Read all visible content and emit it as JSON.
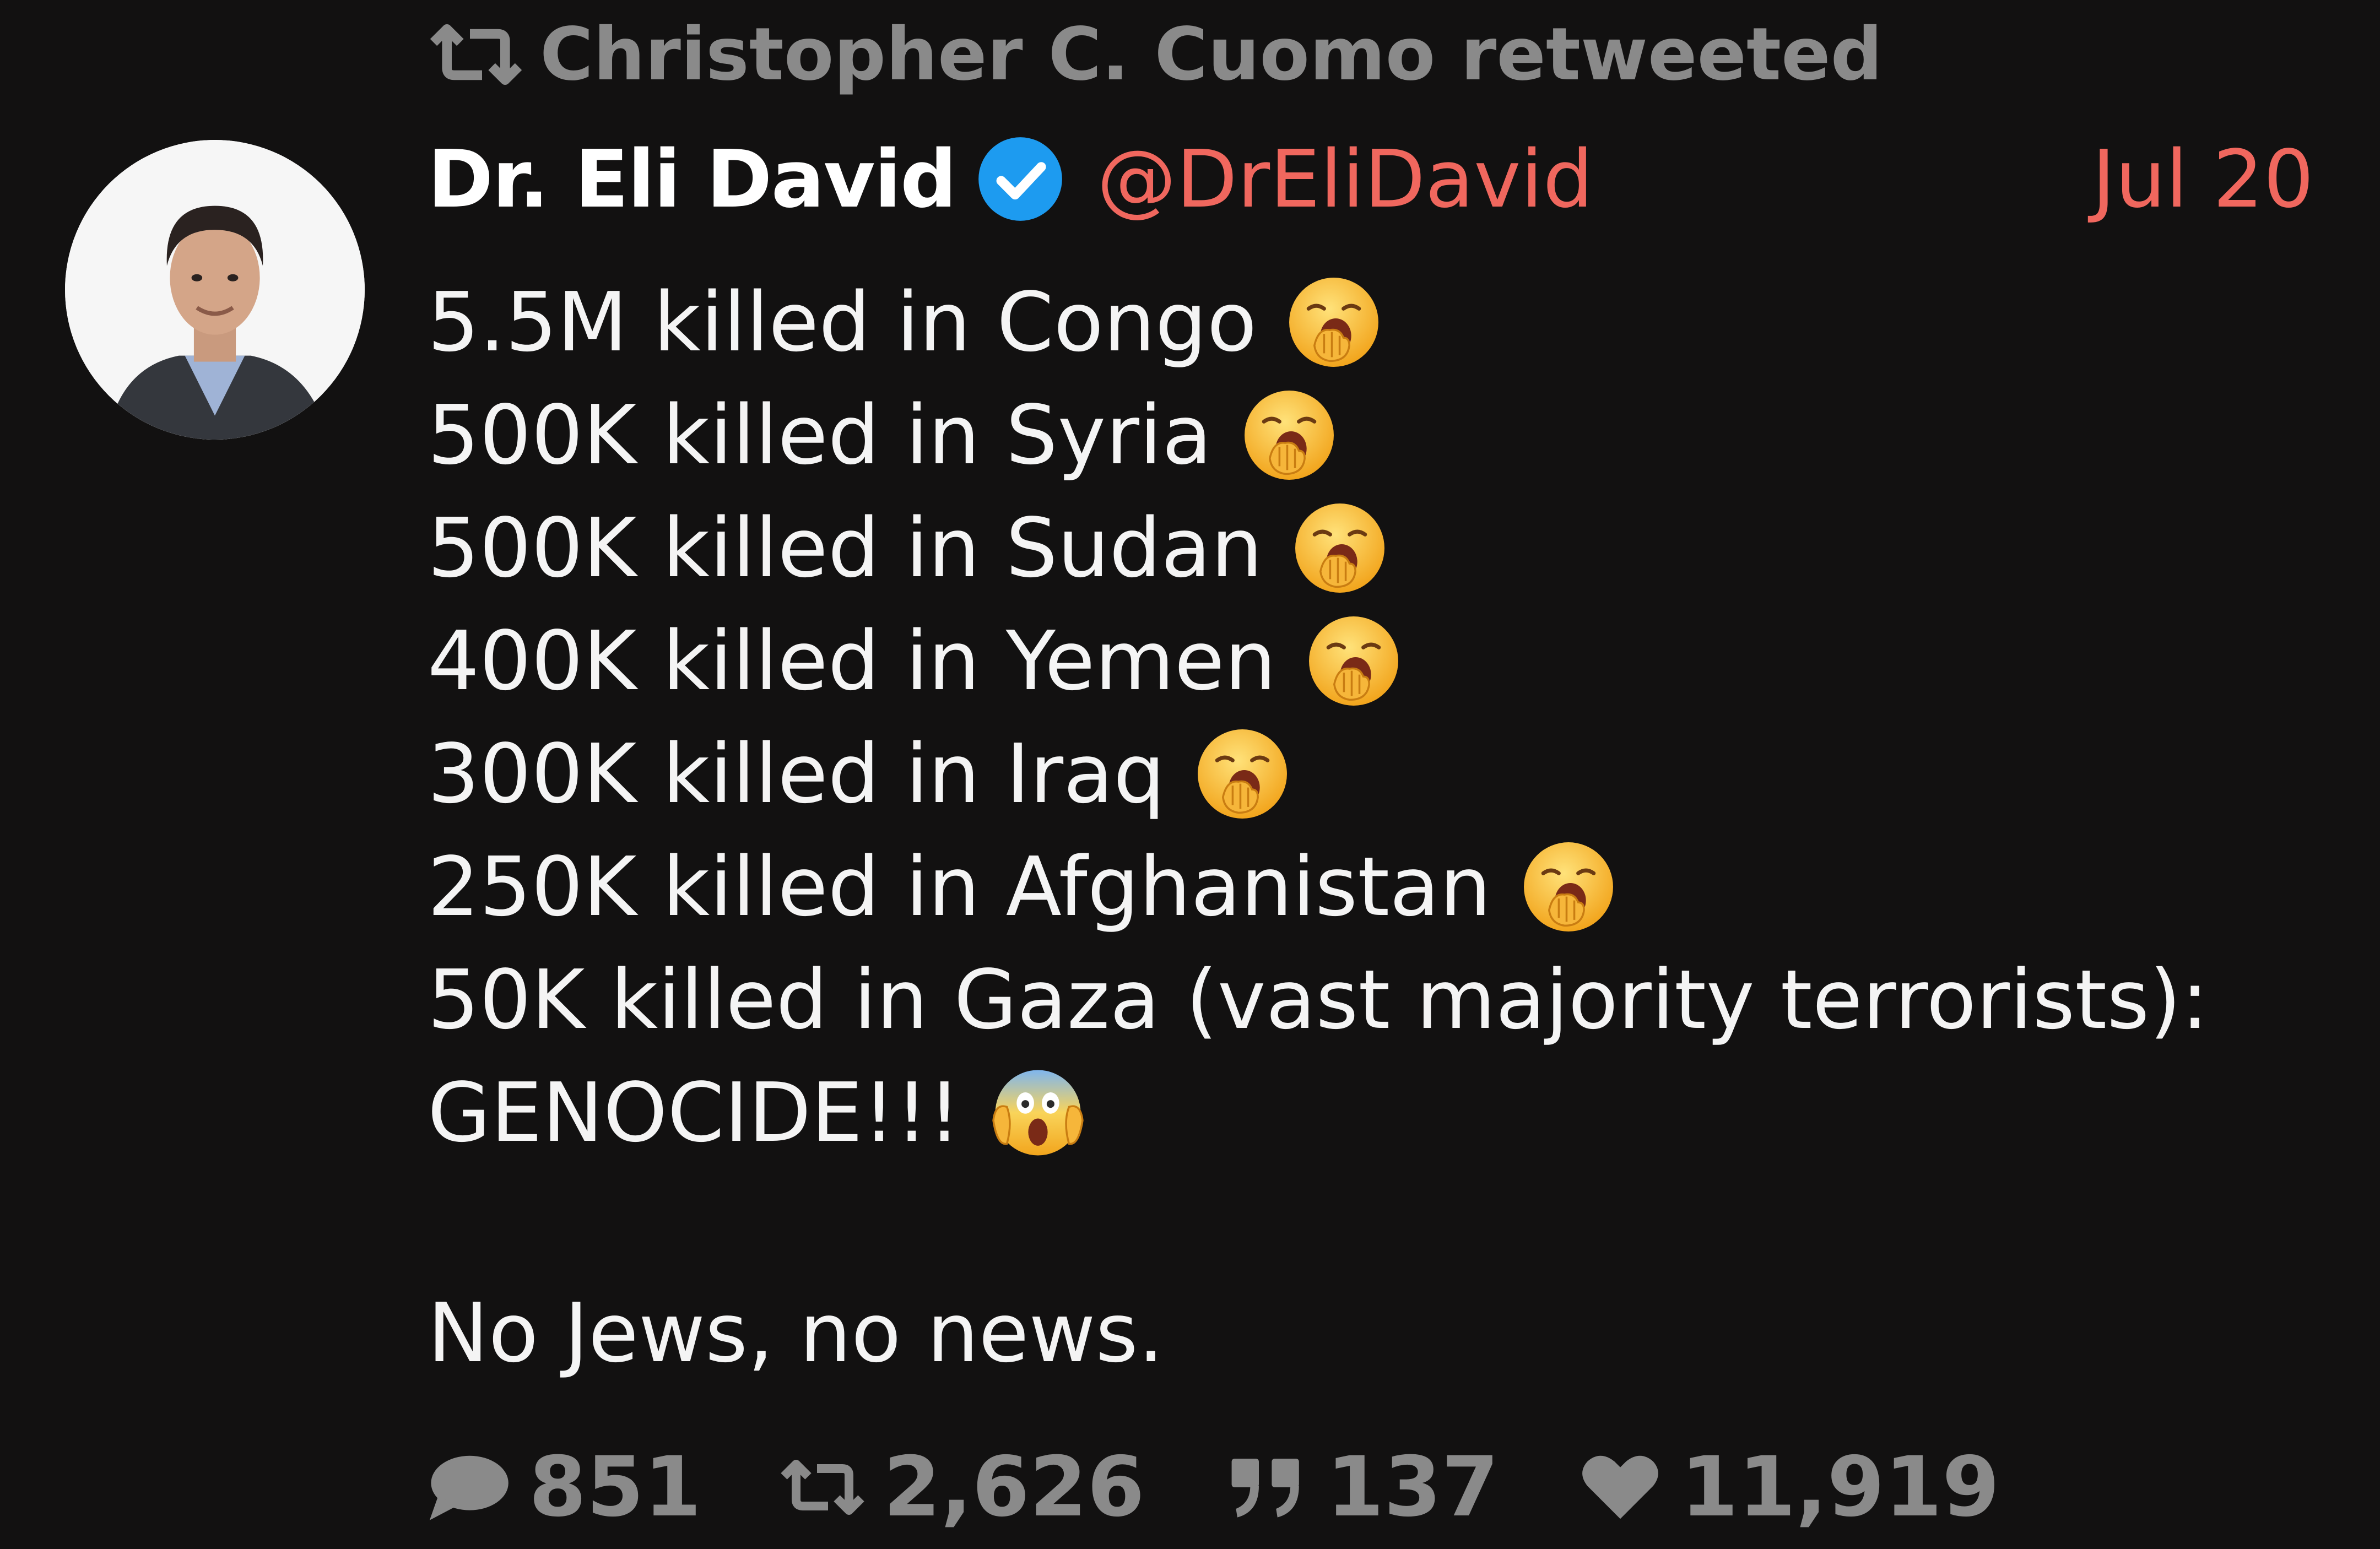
{
  "retweet": {
    "icon": "retweet-icon",
    "text": "Christopher C. Cuomo retweeted"
  },
  "author": {
    "avatar": "avatar",
    "display_name": "Dr. Eli David",
    "verified_icon": "verified-badge-icon",
    "handle": "@DrEliDavid",
    "date": "Jul 20"
  },
  "tweet": {
    "lines": [
      {
        "text": "5.5M killed in Congo",
        "emoji": "yawning-face-emoji"
      },
      {
        "text": "500K killed in Syria",
        "emoji": "yawning-face-emoji"
      },
      {
        "text": "500K killed in Sudan",
        "emoji": "yawning-face-emoji"
      },
      {
        "text": "400K killed in Yemen",
        "emoji": "yawning-face-emoji"
      },
      {
        "text": "300K killed in Iraq",
        "emoji": "yawning-face-emoji"
      },
      {
        "text": "250K killed in Afghanistan",
        "emoji": "yawning-face-emoji"
      },
      {
        "text": "50K killed in Gaza (vast majority terrorists):",
        "emoji": ""
      },
      {
        "text": "GENOCIDE!!!",
        "emoji": "screaming-face-emoji"
      }
    ],
    "closing": "No Jews, no news."
  },
  "actions": {
    "replies": {
      "icon": "reply-icon",
      "count": "851"
    },
    "retweets": {
      "icon": "retweet-icon",
      "count": "2,626"
    },
    "quotes": {
      "icon": "quote-icon",
      "count": "137"
    },
    "likes": {
      "icon": "heart-icon",
      "count": "11,919"
    }
  },
  "colors": {
    "background": "#121111",
    "muted": "#8a8a8a",
    "accent": "#f0675e",
    "verified": "#1d9bf0",
    "text": "#f4f4f4"
  }
}
